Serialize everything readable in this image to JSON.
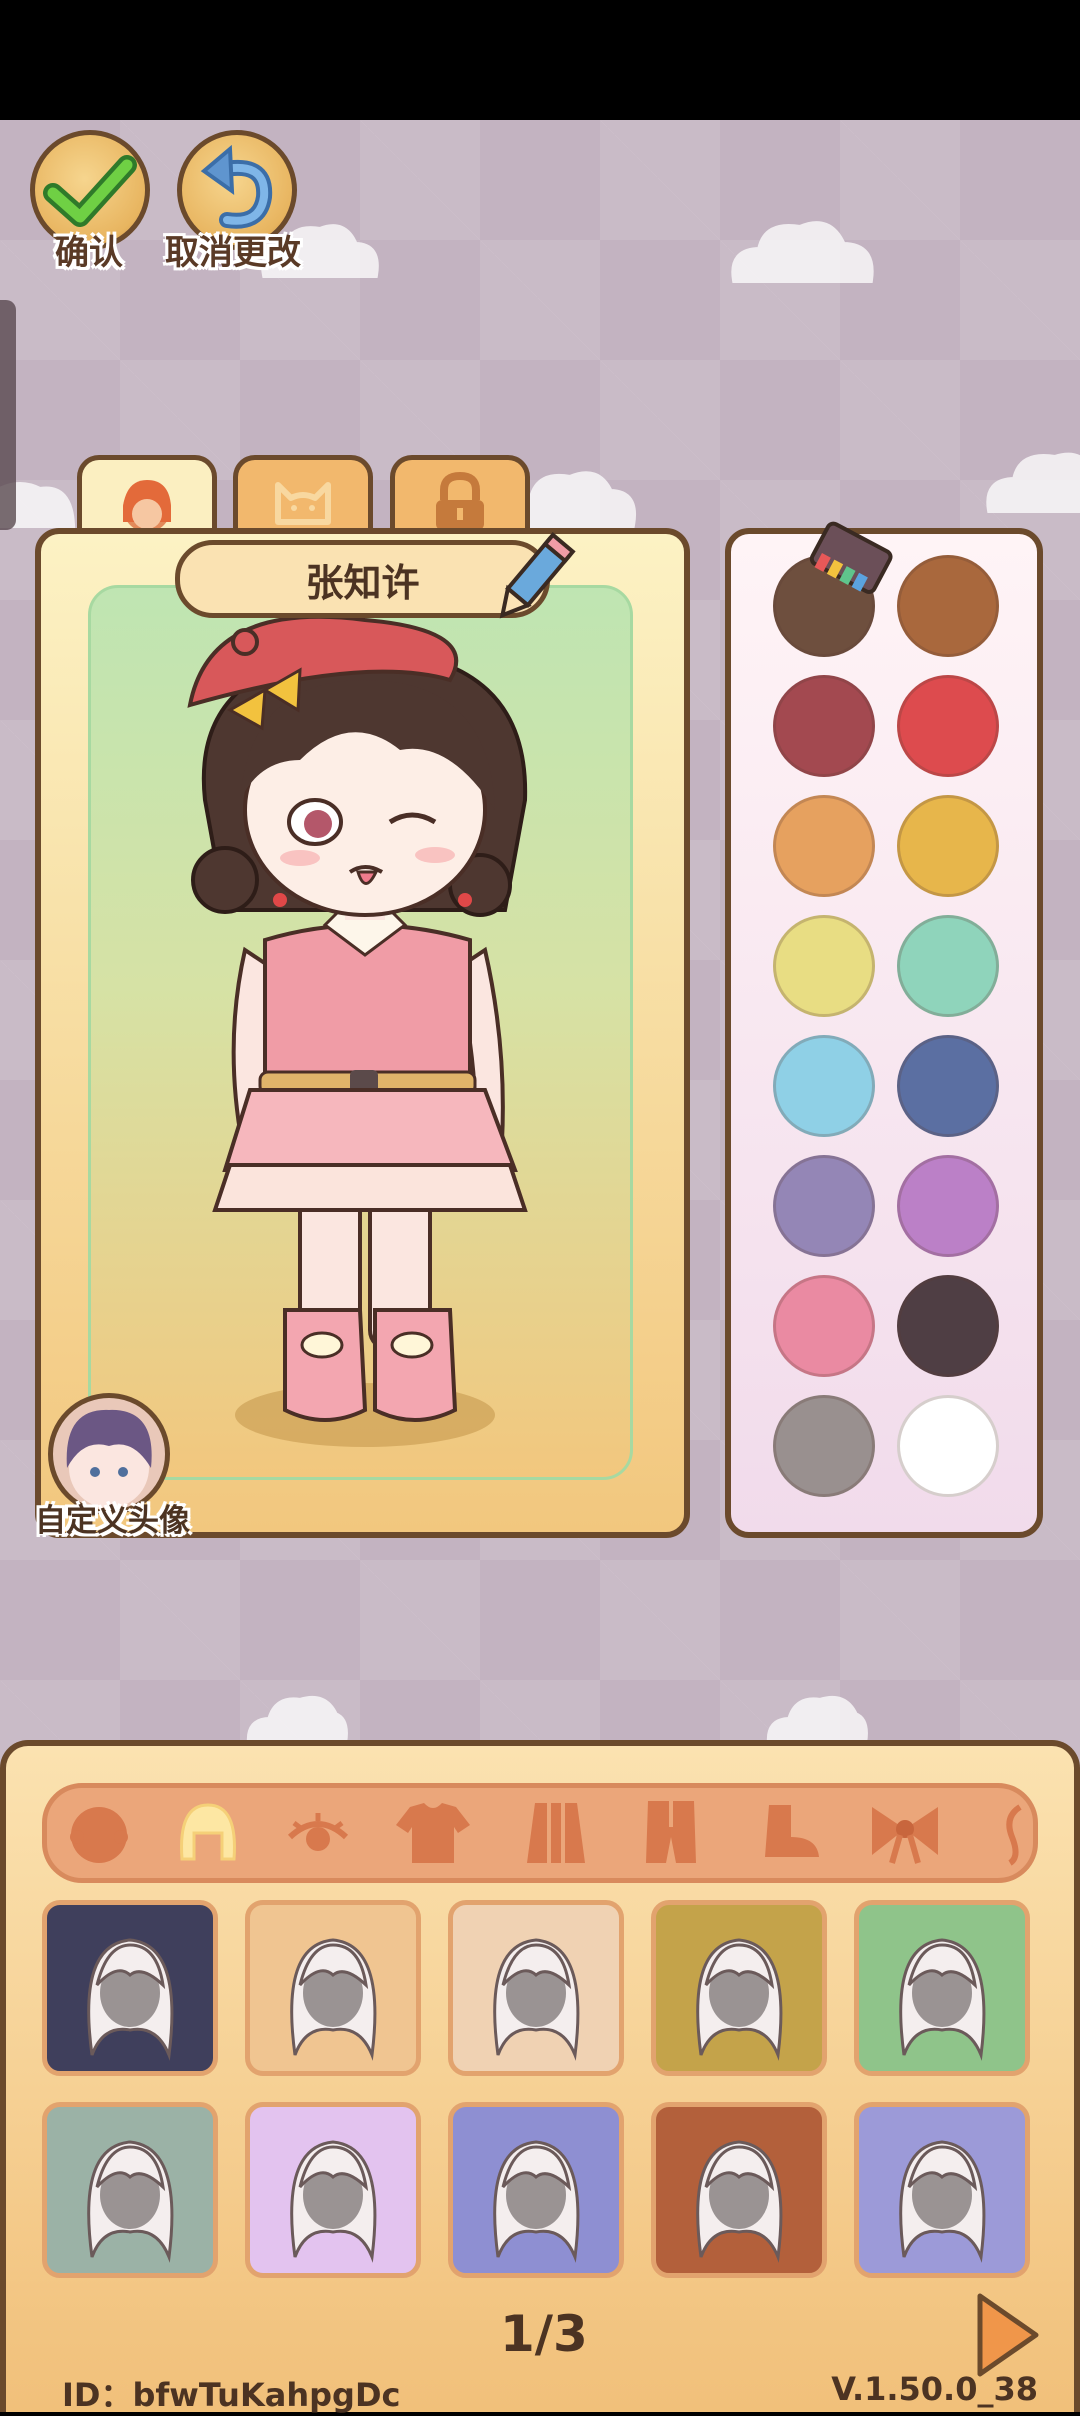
{
  "top_buttons": {
    "confirm_label": "确认",
    "cancel_label": "取消更改"
  },
  "tabs": [
    "avatar-face",
    "cat",
    "lock"
  ],
  "character": {
    "name": "张知许"
  },
  "custom_avatar_label": "自定义头像",
  "palette": {
    "colors": [
      "#6e4f3e",
      "#a9683d",
      "#a34950",
      "#dd4b4e",
      "#e6a15f",
      "#e7b64b",
      "#e8dd83",
      "#8fd4bb",
      "#8fd0e6",
      "#5b6fa2",
      "#9486b6",
      "#bb80c7",
      "#ea8aa2",
      "#4f3e44",
      "#99908f",
      "#ffffff"
    ]
  },
  "categories": [
    "head",
    "hair",
    "eyes",
    "top",
    "coat",
    "outfit",
    "shoes",
    "bow",
    "accessory"
  ],
  "active_category": "hair",
  "items": [
    {
      "bg": "#3f3f5c"
    },
    {
      "bg": "#f0c591"
    },
    {
      "bg": "#f0d2b3"
    },
    {
      "bg": "#c4a34a"
    },
    {
      "bg": "#8fc48a"
    },
    {
      "bg": "#9bb2a6"
    },
    {
      "bg": "#e3c3ef"
    },
    {
      "bg": "#8e8fd2"
    },
    {
      "bg": "#b3603b"
    },
    {
      "bg": "#9c9ad8"
    }
  ],
  "pagination": {
    "text": "1/3"
  },
  "footer": {
    "id": "ID：bfwTuKahpgDc",
    "version": "V.1.50.0_38"
  }
}
